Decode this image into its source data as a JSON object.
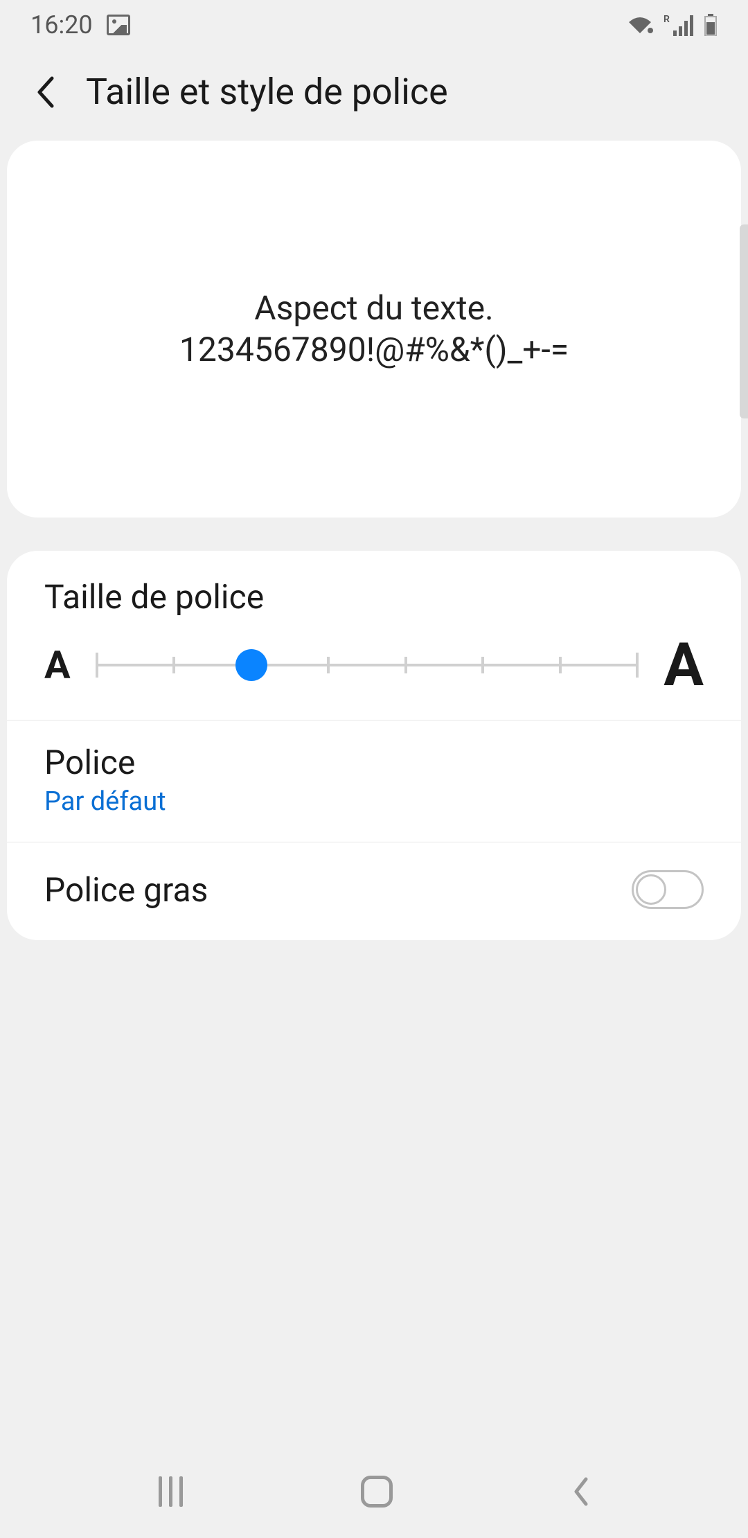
{
  "status": {
    "time": "16:20"
  },
  "header": {
    "title": "Taille et style de police"
  },
  "preview": {
    "line1": "Aspect du texte.",
    "line2": "1234567890!@#%&*()_+-="
  },
  "font_size": {
    "label": "Taille de police",
    "small_marker": "A",
    "large_marker": "A",
    "ticks": 8,
    "value_index": 2
  },
  "font_style": {
    "label": "Police",
    "value": "Par défaut"
  },
  "bold_font": {
    "label": "Police gras",
    "enabled": false
  }
}
